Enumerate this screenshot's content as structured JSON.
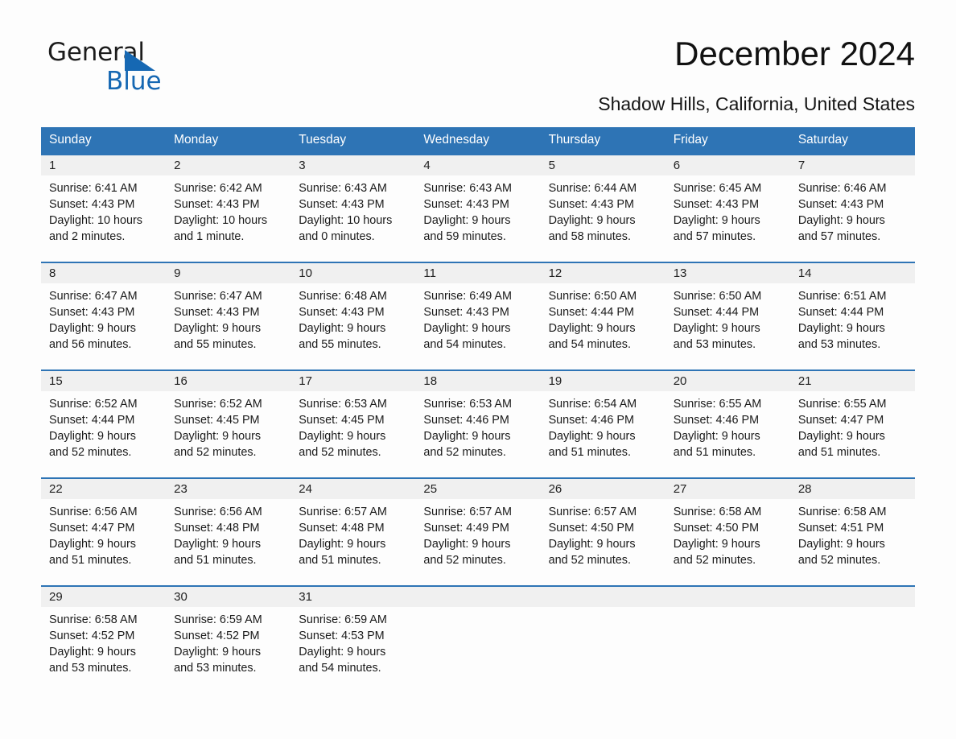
{
  "brand": {
    "name_part1": "General",
    "name_part2": "Blue",
    "triangle_color": "#1668b3"
  },
  "header": {
    "title": "December 2024",
    "location": "Shadow Hills, California, United States"
  },
  "theme": {
    "header_blue": "#2e74b5",
    "daynum_band": "#f0f0f0",
    "page_background": "#fdfdfd",
    "text": "#1a1a1a"
  },
  "weekday_headers": [
    "Sunday",
    "Monday",
    "Tuesday",
    "Wednesday",
    "Thursday",
    "Friday",
    "Saturday"
  ],
  "weeks": [
    [
      {
        "day": "1",
        "sunrise": "Sunrise: 6:41 AM",
        "sunset": "Sunset: 4:43 PM",
        "daylight_line1": "Daylight: 10 hours",
        "daylight_line2": "and 2 minutes."
      },
      {
        "day": "2",
        "sunrise": "Sunrise: 6:42 AM",
        "sunset": "Sunset: 4:43 PM",
        "daylight_line1": "Daylight: 10 hours",
        "daylight_line2": "and 1 minute."
      },
      {
        "day": "3",
        "sunrise": "Sunrise: 6:43 AM",
        "sunset": "Sunset: 4:43 PM",
        "daylight_line1": "Daylight: 10 hours",
        "daylight_line2": "and 0 minutes."
      },
      {
        "day": "4",
        "sunrise": "Sunrise: 6:43 AM",
        "sunset": "Sunset: 4:43 PM",
        "daylight_line1": "Daylight: 9 hours",
        "daylight_line2": "and 59 minutes."
      },
      {
        "day": "5",
        "sunrise": "Sunrise: 6:44 AM",
        "sunset": "Sunset: 4:43 PM",
        "daylight_line1": "Daylight: 9 hours",
        "daylight_line2": "and 58 minutes."
      },
      {
        "day": "6",
        "sunrise": "Sunrise: 6:45 AM",
        "sunset": "Sunset: 4:43 PM",
        "daylight_line1": "Daylight: 9 hours",
        "daylight_line2": "and 57 minutes."
      },
      {
        "day": "7",
        "sunrise": "Sunrise: 6:46 AM",
        "sunset": "Sunset: 4:43 PM",
        "daylight_line1": "Daylight: 9 hours",
        "daylight_line2": "and 57 minutes."
      }
    ],
    [
      {
        "day": "8",
        "sunrise": "Sunrise: 6:47 AM",
        "sunset": "Sunset: 4:43 PM",
        "daylight_line1": "Daylight: 9 hours",
        "daylight_line2": "and 56 minutes."
      },
      {
        "day": "9",
        "sunrise": "Sunrise: 6:47 AM",
        "sunset": "Sunset: 4:43 PM",
        "daylight_line1": "Daylight: 9 hours",
        "daylight_line2": "and 55 minutes."
      },
      {
        "day": "10",
        "sunrise": "Sunrise: 6:48 AM",
        "sunset": "Sunset: 4:43 PM",
        "daylight_line1": "Daylight: 9 hours",
        "daylight_line2": "and 55 minutes."
      },
      {
        "day": "11",
        "sunrise": "Sunrise: 6:49 AM",
        "sunset": "Sunset: 4:43 PM",
        "daylight_line1": "Daylight: 9 hours",
        "daylight_line2": "and 54 minutes."
      },
      {
        "day": "12",
        "sunrise": "Sunrise: 6:50 AM",
        "sunset": "Sunset: 4:44 PM",
        "daylight_line1": "Daylight: 9 hours",
        "daylight_line2": "and 54 minutes."
      },
      {
        "day": "13",
        "sunrise": "Sunrise: 6:50 AM",
        "sunset": "Sunset: 4:44 PM",
        "daylight_line1": "Daylight: 9 hours",
        "daylight_line2": "and 53 minutes."
      },
      {
        "day": "14",
        "sunrise": "Sunrise: 6:51 AM",
        "sunset": "Sunset: 4:44 PM",
        "daylight_line1": "Daylight: 9 hours",
        "daylight_line2": "and 53 minutes."
      }
    ],
    [
      {
        "day": "15",
        "sunrise": "Sunrise: 6:52 AM",
        "sunset": "Sunset: 4:44 PM",
        "daylight_line1": "Daylight: 9 hours",
        "daylight_line2": "and 52 minutes."
      },
      {
        "day": "16",
        "sunrise": "Sunrise: 6:52 AM",
        "sunset": "Sunset: 4:45 PM",
        "daylight_line1": "Daylight: 9 hours",
        "daylight_line2": "and 52 minutes."
      },
      {
        "day": "17",
        "sunrise": "Sunrise: 6:53 AM",
        "sunset": "Sunset: 4:45 PM",
        "daylight_line1": "Daylight: 9 hours",
        "daylight_line2": "and 52 minutes."
      },
      {
        "day": "18",
        "sunrise": "Sunrise: 6:53 AM",
        "sunset": "Sunset: 4:46 PM",
        "daylight_line1": "Daylight: 9 hours",
        "daylight_line2": "and 52 minutes."
      },
      {
        "day": "19",
        "sunrise": "Sunrise: 6:54 AM",
        "sunset": "Sunset: 4:46 PM",
        "daylight_line1": "Daylight: 9 hours",
        "daylight_line2": "and 51 minutes."
      },
      {
        "day": "20",
        "sunrise": "Sunrise: 6:55 AM",
        "sunset": "Sunset: 4:46 PM",
        "daylight_line1": "Daylight: 9 hours",
        "daylight_line2": "and 51 minutes."
      },
      {
        "day": "21",
        "sunrise": "Sunrise: 6:55 AM",
        "sunset": "Sunset: 4:47 PM",
        "daylight_line1": "Daylight: 9 hours",
        "daylight_line2": "and 51 minutes."
      }
    ],
    [
      {
        "day": "22",
        "sunrise": "Sunrise: 6:56 AM",
        "sunset": "Sunset: 4:47 PM",
        "daylight_line1": "Daylight: 9 hours",
        "daylight_line2": "and 51 minutes."
      },
      {
        "day": "23",
        "sunrise": "Sunrise: 6:56 AM",
        "sunset": "Sunset: 4:48 PM",
        "daylight_line1": "Daylight: 9 hours",
        "daylight_line2": "and 51 minutes."
      },
      {
        "day": "24",
        "sunrise": "Sunrise: 6:57 AM",
        "sunset": "Sunset: 4:48 PM",
        "daylight_line1": "Daylight: 9 hours",
        "daylight_line2": "and 51 minutes."
      },
      {
        "day": "25",
        "sunrise": "Sunrise: 6:57 AM",
        "sunset": "Sunset: 4:49 PM",
        "daylight_line1": "Daylight: 9 hours",
        "daylight_line2": "and 52 minutes."
      },
      {
        "day": "26",
        "sunrise": "Sunrise: 6:57 AM",
        "sunset": "Sunset: 4:50 PM",
        "daylight_line1": "Daylight: 9 hours",
        "daylight_line2": "and 52 minutes."
      },
      {
        "day": "27",
        "sunrise": "Sunrise: 6:58 AM",
        "sunset": "Sunset: 4:50 PM",
        "daylight_line1": "Daylight: 9 hours",
        "daylight_line2": "and 52 minutes."
      },
      {
        "day": "28",
        "sunrise": "Sunrise: 6:58 AM",
        "sunset": "Sunset: 4:51 PM",
        "daylight_line1": "Daylight: 9 hours",
        "daylight_line2": "and 52 minutes."
      }
    ],
    [
      {
        "day": "29",
        "sunrise": "Sunrise: 6:58 AM",
        "sunset": "Sunset: 4:52 PM",
        "daylight_line1": "Daylight: 9 hours",
        "daylight_line2": "and 53 minutes."
      },
      {
        "day": "30",
        "sunrise": "Sunrise: 6:59 AM",
        "sunset": "Sunset: 4:52 PM",
        "daylight_line1": "Daylight: 9 hours",
        "daylight_line2": "and 53 minutes."
      },
      {
        "day": "31",
        "sunrise": "Sunrise: 6:59 AM",
        "sunset": "Sunset: 4:53 PM",
        "daylight_line1": "Daylight: 9 hours",
        "daylight_line2": "and 54 minutes."
      },
      {
        "day": "",
        "sunrise": "",
        "sunset": "",
        "daylight_line1": "",
        "daylight_line2": ""
      },
      {
        "day": "",
        "sunrise": "",
        "sunset": "",
        "daylight_line1": "",
        "daylight_line2": ""
      },
      {
        "day": "",
        "sunrise": "",
        "sunset": "",
        "daylight_line1": "",
        "daylight_line2": ""
      },
      {
        "day": "",
        "sunrise": "",
        "sunset": "",
        "daylight_line1": "",
        "daylight_line2": ""
      }
    ]
  ]
}
